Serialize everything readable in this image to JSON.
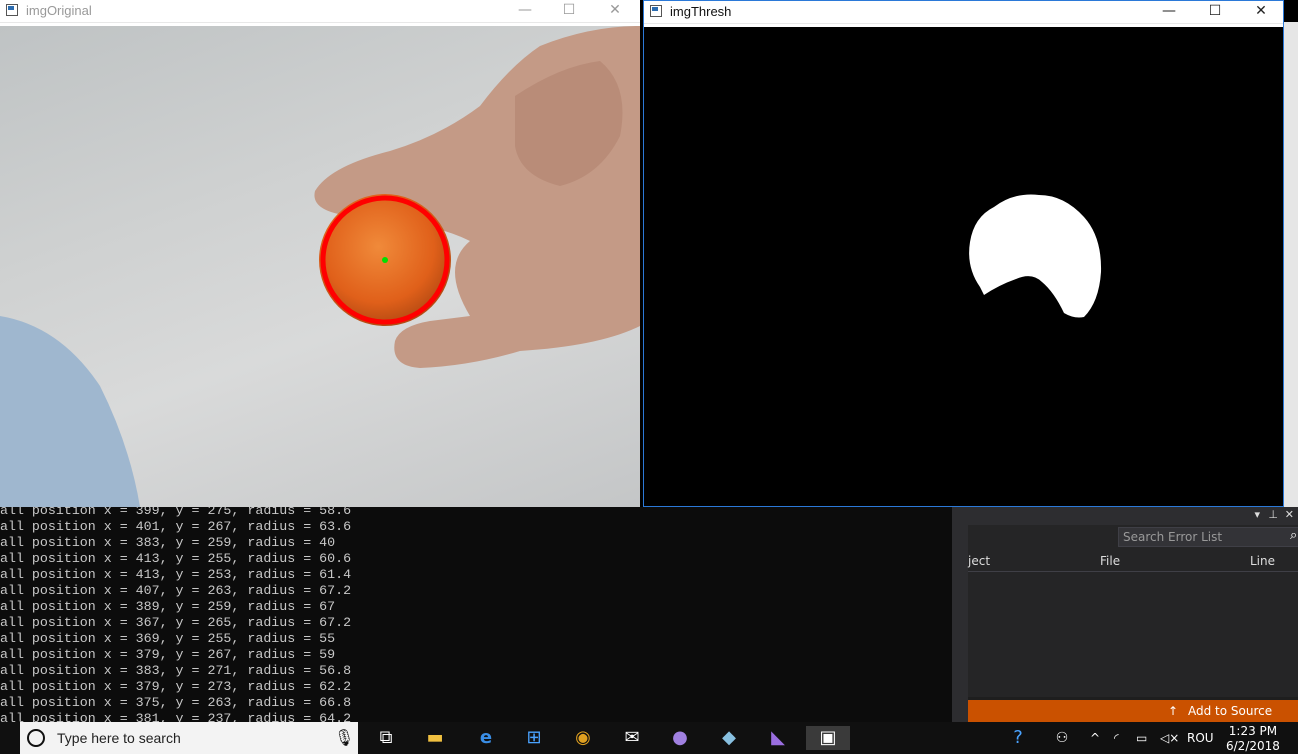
{
  "windows": {
    "original": {
      "title": "imgOriginal"
    },
    "thresh": {
      "title": "imgThresh"
    }
  },
  "console": {
    "lines": [
      "all position x = 399, y = 275, radius = 58.6",
      "all position x = 401, y = 267, radius = 63.6",
      "all position x = 383, y = 259, radius = 40",
      "all position x = 413, y = 255, radius = 60.6",
      "all position x = 413, y = 253, radius = 61.4",
      "all position x = 407, y = 263, radius = 67.2",
      "all position x = 389, y = 259, radius = 67",
      "all position x = 367, y = 265, radius = 67.2",
      "all position x = 369, y = 255, radius = 55",
      "all position x = 379, y = 267, radius = 59",
      "all position x = 383, y = 271, radius = 56.8",
      "all position x = 379, y = 273, radius = 62.2",
      "all position x = 375, y = 263, radius = 66.8",
      "all position x = 381, y = 237, radius = 64.2"
    ]
  },
  "error_list": {
    "search_placeholder": "Search Error List",
    "col_project": "ject",
    "col_file": "File",
    "col_line": "Line",
    "add_source_control": "Add to Source Contro"
  },
  "taskbar": {
    "search_placeholder": "Type here to search",
    "language": "ROU",
    "time": "1:23 PM",
    "date": "6/2/2018"
  },
  "colors": {
    "ball": "#e8641e",
    "detection_circle": "#ff0000",
    "center_dot": "#00e000",
    "accent": "#ca5100"
  }
}
